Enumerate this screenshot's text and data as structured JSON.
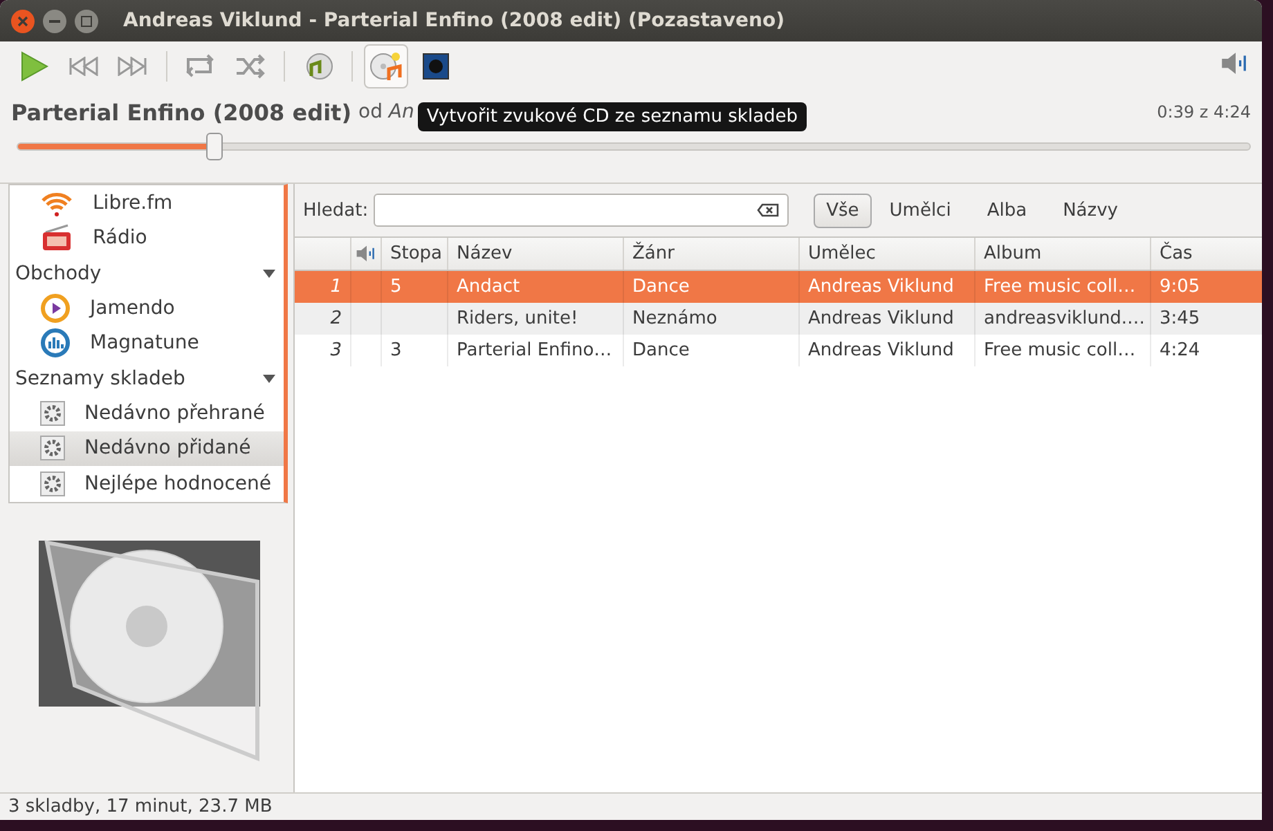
{
  "window": {
    "title": "Andreas Viklund - Parterial Enfino (2008 edit) (Pozastaveno)"
  },
  "toolbar": {
    "groups": [
      [
        {
          "kind": "play",
          "hovered": false
        },
        {
          "kind": "prev",
          "hovered": false
        },
        {
          "kind": "next",
          "hovered": false
        }
      ],
      [
        {
          "kind": "repeat",
          "hovered": false
        },
        {
          "kind": "shuffle",
          "hovered": false
        }
      ],
      [
        {
          "kind": "music",
          "hovered": false
        }
      ],
      [
        {
          "kind": "burn",
          "hovered": true
        },
        {
          "kind": "visual",
          "hovered": false
        }
      ]
    ],
    "tooltip": "Vytvořit zvukové CD ze seznamu skladeb"
  },
  "now_playing": {
    "title": "Parterial Enfino (2008 edit)",
    "byline": "od *An*",
    "time": "0:39 z 4:24",
    "level": 0.16
  },
  "sidebar": {
    "items": [
      {
        "kind": "wifi",
        "label": "Libre.fm",
        "selected": false
      },
      {
        "kind": "radio",
        "label": "Rádio",
        "selected": false
      },
      {
        "kind": "header",
        "label": "Obchody",
        "expanded": true
      },
      {
        "kind": "jamendo",
        "label": "Jamendo",
        "selected": false
      },
      {
        "kind": "magnatune",
        "label": "Magnatune",
        "selected": false
      },
      {
        "kind": "header",
        "label": "Seznamy skladeb",
        "expanded": true
      },
      {
        "kind": "playlist",
        "label": "Nedávno přehrané",
        "selected": false
      },
      {
        "kind": "playlist",
        "label": "Nedávno přidané",
        "selected": true
      },
      {
        "kind": "playlist",
        "label": "Nejlépe hodnocené",
        "selected": false
      }
    ]
  },
  "search": {
    "label": "Hledat:",
    "filters": [
      {
        "label": "Vše",
        "selected": true
      },
      {
        "label": "Umělci",
        "selected": false
      },
      {
        "label": "Alba",
        "selected": false
      },
      {
        "label": "Názvy",
        "selected": false
      }
    ]
  },
  "table": {
    "columns": [
      "Stopa",
      "Název",
      "Žánr",
      "Umělec",
      "Album",
      "Čas"
    ],
    "rows": [
      {
        "index": "1",
        "selected": true,
        "cells": [
          "5",
          "Andact",
          "Dance",
          "Andreas Viklund",
          "Free music coll…",
          "9:05"
        ]
      },
      {
        "index": "2",
        "selected": false,
        "cells": [
          "",
          "Riders, unite!",
          "Neznámo",
          "Andreas Viklund",
          "andreasviklund.…",
          "3:45"
        ]
      },
      {
        "index": "3",
        "selected": false,
        "cells": [
          "3",
          "Parterial Enfino…",
          "Dance",
          "Andreas Viklund",
          "Free music coll…",
          "4:24"
        ]
      }
    ]
  },
  "status_bar": "3 skladby, 17 minut, 23.7 MB"
}
